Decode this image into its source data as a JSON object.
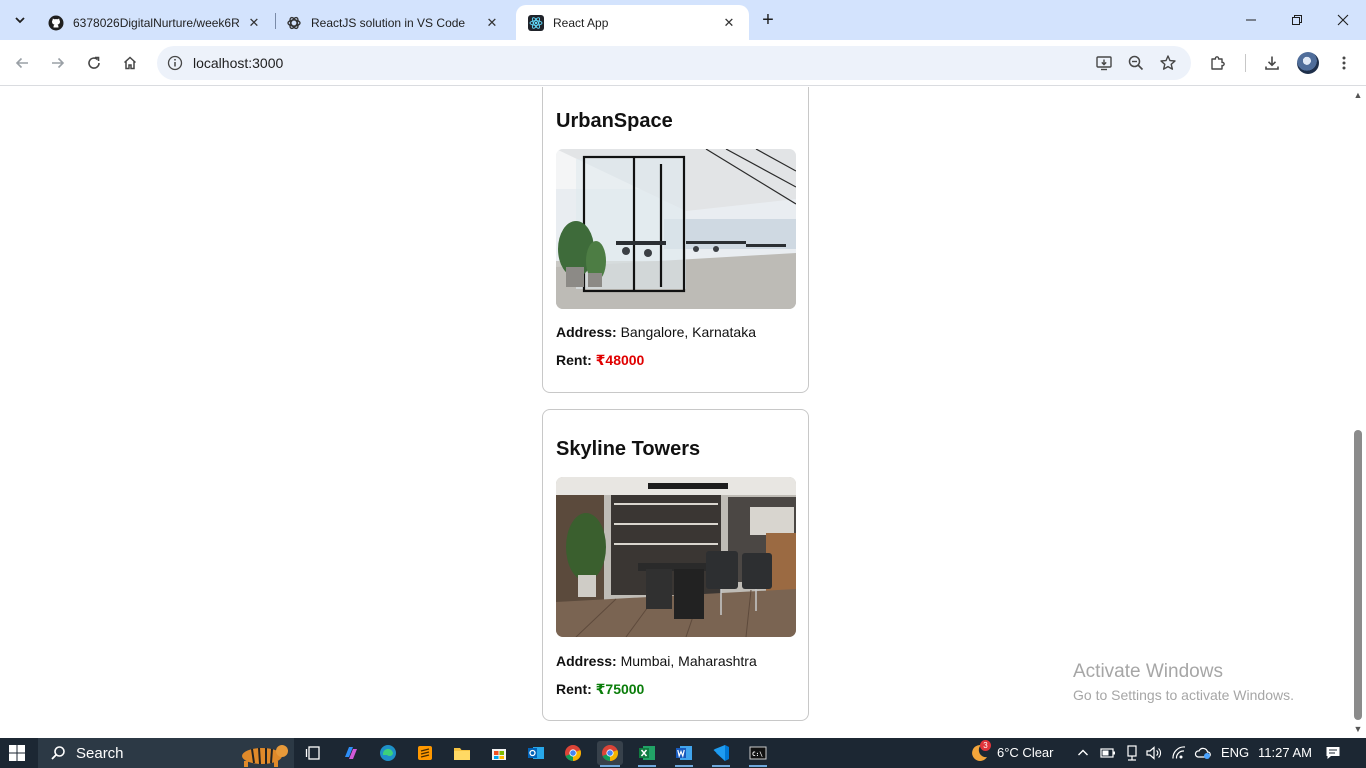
{
  "browser": {
    "tabs": [
      {
        "title": "6378026DigitalNurture/week6R",
        "icon": "github-icon",
        "active": false
      },
      {
        "title": "ReactJS solution in VS Code",
        "icon": "chatgpt-icon",
        "active": false
      },
      {
        "title": "React App",
        "icon": "react-icon",
        "active": true
      }
    ],
    "url": "localhost:3000"
  },
  "offices": [
    {
      "name": "UrbanSpace",
      "address_label": "Address:",
      "address": "Bangalore, Karnataka",
      "rent_label": "Rent:",
      "rent": "₹48000",
      "rent_color": "#e00000"
    },
    {
      "name": "Skyline Towers",
      "address_label": "Address:",
      "address": "Mumbai, Maharashtra",
      "rent_label": "Rent:",
      "rent": "₹75000",
      "rent_color": "#0a7d0a"
    }
  ],
  "watermark": {
    "line1": "Activate Windows",
    "line2": "Go to Settings to activate Windows."
  },
  "taskbar": {
    "search_label": "Search",
    "weather": "6°C  Clear",
    "weather_badge": "3",
    "language": "ENG",
    "time": "11:27 AM"
  }
}
